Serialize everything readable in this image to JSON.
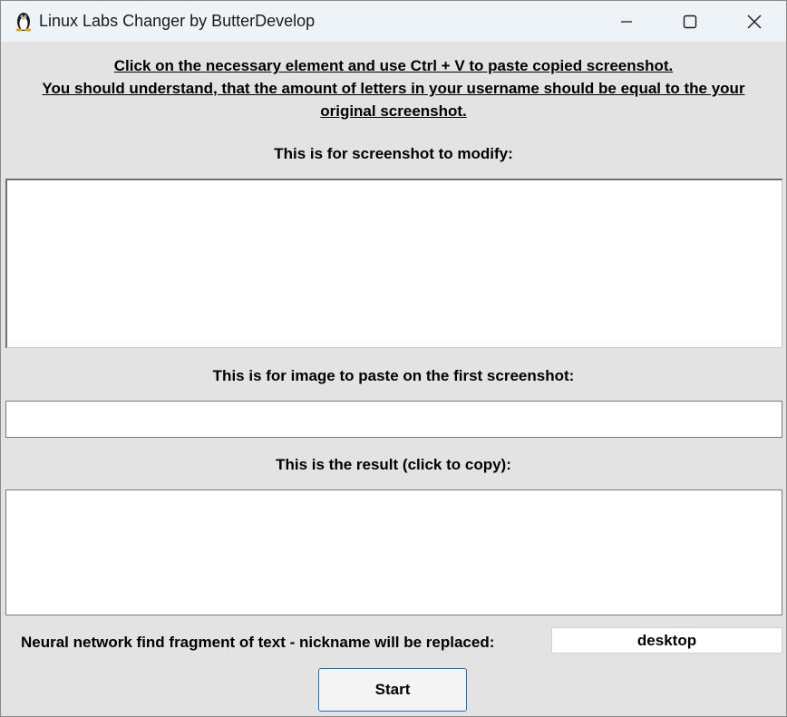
{
  "window": {
    "title": "Linux Labs Changer by ButterDevelop",
    "icon": "penguin-icon"
  },
  "instructions": {
    "line1": "Click on the necessary element and use Ctrl + V to paste copied screenshot.",
    "line2": "You should understand, that the amount of letters in your username should be equal to the your",
    "line3": "original screenshot."
  },
  "sections": {
    "modify_label": "This is for screenshot to modify:",
    "paste_label": "This is for image to paste on the first screenshot:",
    "result_label": "This is the result (click to copy):"
  },
  "nickname": {
    "label": "Neural network find fragment of text - nickname will be replaced:",
    "value": "desktop"
  },
  "buttons": {
    "start": "Start"
  }
}
